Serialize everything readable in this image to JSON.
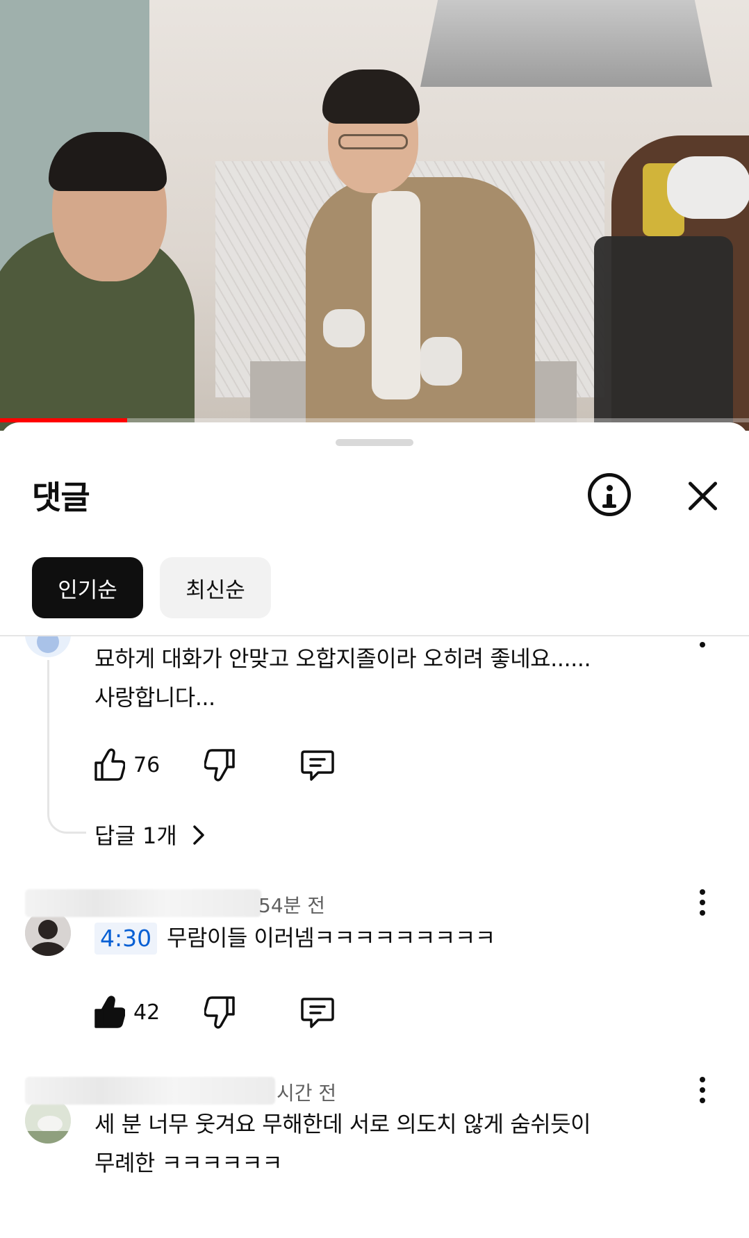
{
  "video": {
    "progress_fraction": 0.17,
    "progress_color": "#ff0000"
  },
  "sheet": {
    "title": "댓글",
    "info_icon": "info-icon",
    "close_icon": "close-icon",
    "chips": [
      {
        "label": "인기순",
        "selected": true
      },
      {
        "label": "최신순",
        "selected": false
      }
    ]
  },
  "comments": [
    {
      "text_line1": "묘하게 대화가 안맞고 오합지졸이라 오히려 좋네요......",
      "text_line2": "사랑합니다...",
      "likes": "76",
      "liked": false,
      "replies_label": "답글 1개"
    },
    {
      "time": "54분 전",
      "timestamp": "4:30",
      "text": "무람이들 이러넴ㅋㅋㅋㅋㅋㅋㅋㅋㅋ",
      "likes": "42",
      "liked": true
    },
    {
      "time": "시간 전",
      "text_line1": "세 분 너무 웃겨요 무해한데 서로 의도치 않게 숨쉬듯이",
      "text_line2": "무례한 ㅋㅋㅋㅋㅋㅋ"
    }
  ],
  "icons": {
    "like": "thumbs-up-icon",
    "dislike": "thumbs-down-icon",
    "reply": "reply-comment-icon",
    "more": "more-vert-icon",
    "chevron": "chevron-right-icon"
  }
}
